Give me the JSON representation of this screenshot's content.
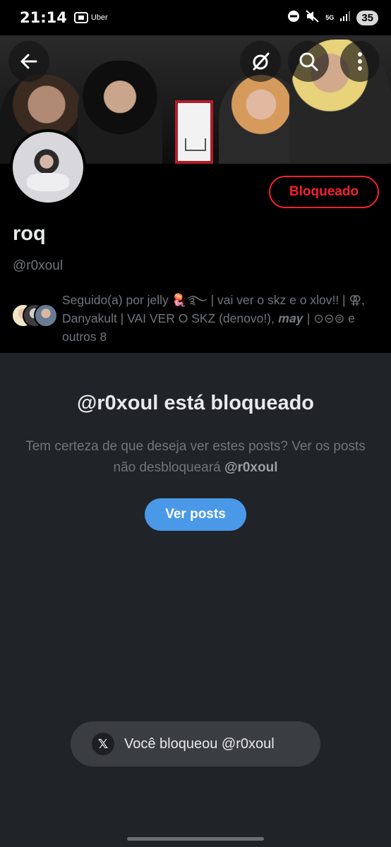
{
  "status_bar": {
    "time": "21:14",
    "app_label": "Uber",
    "network": "5G",
    "battery": "35"
  },
  "banner": {
    "back_icon": "arrow-left-icon",
    "grok_icon": "slashed-circle-icon",
    "search_icon": "search-icon",
    "more_icon": "more-vertical-icon"
  },
  "profile": {
    "display_name": "roq",
    "handle": "@r0xoul",
    "blocked_button_label": "Bloqueado",
    "followed_by_text": "Seguido(a) por jelly 🪼࿐ | vai ver o skz e o xlov!! | ⚢, Danyakult | VAI VER O SKZ (denovo!), 𝒎𝒂𝒚 | ⊙⊝⊜ e outros 8"
  },
  "blocked_notice": {
    "title": "@r0xoul está bloqueado",
    "description_prefix": "Tem certeza de que deseja ver estes posts? Ver os posts não desbloqueará ",
    "description_handle": "@r0xoul",
    "view_posts_label": "Ver posts"
  },
  "toast": {
    "icon": "x-logo-icon",
    "text": "Você bloqueou @r0xoul"
  },
  "colors": {
    "accent_blue": "#4a99e9",
    "blocked_red": "#f4212e",
    "background_lower": "#202327"
  }
}
